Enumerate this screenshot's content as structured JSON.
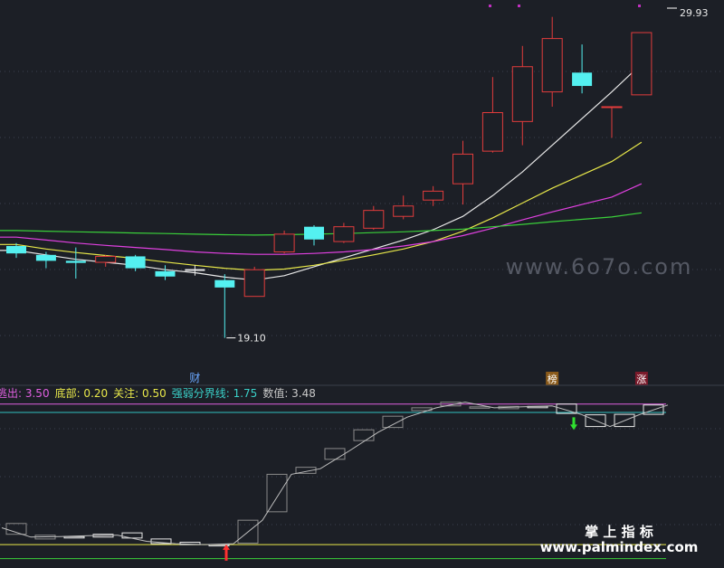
{
  "chart_data": [
    {
      "type": "candlestick",
      "panel": "price",
      "ylim": [
        17.5,
        30.5
      ],
      "max_label": "29.93",
      "min_label": "19.10",
      "candles": [
        {
          "open": 22.2,
          "close": 21.95,
          "high": 22.3,
          "low": 21.8,
          "color": "cyan"
        },
        {
          "open": 21.9,
          "close": 21.7,
          "high": 22.0,
          "low": 21.45,
          "color": "cyan"
        },
        {
          "open": 21.7,
          "close": 21.63,
          "high": 22.15,
          "low": 21.1,
          "color": "cyan"
        },
        {
          "open": 21.85,
          "close": 21.65,
          "high": 21.9,
          "low": 21.5,
          "color": "red"
        },
        {
          "open": 21.85,
          "close": 21.45,
          "high": 21.9,
          "low": 21.35,
          "color": "cyan"
        },
        {
          "open": 21.35,
          "close": 21.17,
          "high": 21.55,
          "low": 21.05,
          "color": "cyan"
        },
        {
          "open": 21.42,
          "close": 21.36,
          "high": 21.55,
          "low": 21.2,
          "color": "white"
        },
        {
          "open": 21.05,
          "close": 20.8,
          "high": 21.25,
          "low": 19.1,
          "color": "cyan"
        },
        {
          "open": 20.5,
          "close": 21.4,
          "high": 21.5,
          "low": 20.5,
          "color": "red"
        },
        {
          "open": 22.0,
          "close": 22.6,
          "high": 22.72,
          "low": 21.95,
          "color": "red"
        },
        {
          "open": 22.85,
          "close": 22.42,
          "high": 22.9,
          "low": 22.22,
          "color": "cyan"
        },
        {
          "open": 22.35,
          "close": 22.85,
          "high": 22.98,
          "low": 22.3,
          "color": "red"
        },
        {
          "open": 22.8,
          "close": 23.4,
          "high": 23.55,
          "low": 22.75,
          "color": "red"
        },
        {
          "open": 23.2,
          "close": 23.55,
          "high": 23.9,
          "low": 23.1,
          "color": "red"
        },
        {
          "open": 23.75,
          "close": 24.05,
          "high": 24.22,
          "low": 23.55,
          "color": "red"
        },
        {
          "open": 24.3,
          "close": 25.3,
          "high": 25.75,
          "low": 23.6,
          "color": "red"
        },
        {
          "open": 25.4,
          "close": 26.7,
          "high": 27.9,
          "low": 25.35,
          "color": "red"
        },
        {
          "open": 26.4,
          "close": 28.25,
          "high": 28.95,
          "low": 25.6,
          "color": "red"
        },
        {
          "open": 27.4,
          "close": 29.2,
          "high": 29.93,
          "low": 26.9,
          "color": "red"
        },
        {
          "open": 28.05,
          "close": 27.6,
          "high": 29.0,
          "low": 27.35,
          "color": "cyan"
        },
        {
          "open": 26.9,
          "close": 26.9,
          "high": 26.9,
          "low": 25.85,
          "color": "red"
        },
        {
          "open": 27.3,
          "close": 29.4,
          "high": 29.4,
          "low": 27.3,
          "color": "red"
        }
      ],
      "ma_lines": [
        {
          "color": "#e8e8e8",
          "values": [
            22.05,
            21.9,
            21.75,
            21.65,
            21.55,
            21.4,
            21.3,
            21.15,
            21.05,
            21.2,
            21.5,
            21.8,
            22.1,
            22.4,
            22.75,
            23.2,
            23.9,
            24.7,
            25.6,
            26.5,
            27.4,
            28.35
          ]
        },
        {
          "color": "#e8e84a",
          "values": [
            22.25,
            22.1,
            21.98,
            21.88,
            21.78,
            21.66,
            21.55,
            21.45,
            21.38,
            21.42,
            21.55,
            21.72,
            21.9,
            22.1,
            22.35,
            22.7,
            23.15,
            23.65,
            24.15,
            24.6,
            25.05,
            25.7
          ]
        },
        {
          "color": "#e040e0",
          "values": [
            22.5,
            22.4,
            22.3,
            22.22,
            22.15,
            22.08,
            22.0,
            21.95,
            21.92,
            21.92,
            21.95,
            22.0,
            22.08,
            22.2,
            22.35,
            22.55,
            22.8,
            23.08,
            23.35,
            23.6,
            23.85,
            24.3
          ]
        },
        {
          "color": "#3ad03a",
          "values": [
            22.72,
            22.7,
            22.68,
            22.66,
            22.64,
            22.62,
            22.6,
            22.58,
            22.57,
            22.58,
            22.6,
            22.62,
            22.65,
            22.68,
            22.72,
            22.77,
            22.85,
            22.93,
            23.02,
            23.1,
            23.18,
            23.32
          ]
        }
      ],
      "markers": [
        {
          "index": 6,
          "label": "财"
        },
        {
          "index": 18,
          "label": "榜"
        },
        {
          "index": 21,
          "label": "涨"
        }
      ]
    },
    {
      "type": "indicator",
      "panel": "lower",
      "ylim": [
        0,
        3.9
      ],
      "legend": [
        {
          "label": "逃出: 3.50",
          "color": "#e060e0"
        },
        {
          "label": "底部: 0.20",
          "color": "#e8e84a"
        },
        {
          "label": "关注: 0.50",
          "color": "#e8e84a"
        },
        {
          "label": "强弱分界线: 1.75",
          "color": "#3ad0c8"
        },
        {
          "label": "数值: 3.48",
          "color": "#c8c8c8"
        }
      ],
      "levels": [
        {
          "name": "逃出",
          "value": 3.5,
          "color": "#e060e0"
        },
        {
          "name": "强弱分界线",
          "value": 3.32,
          "color": "#30c0c0"
        },
        {
          "name": "关注",
          "value": 0.5,
          "color": "#e8e84a"
        },
        {
          "name": "底部",
          "value": 0.2,
          "color": "#3ad03a"
        }
      ],
      "boxes": [
        {
          "open": 0.72,
          "close": 0.95
        },
        {
          "open": 0.62,
          "close": 0.7
        },
        {
          "open": 0.67,
          "close": 0.67
        },
        {
          "open": 0.72,
          "close": 0.66
        },
        {
          "open": 0.75,
          "close": 0.64
        },
        {
          "open": 0.62,
          "close": 0.52
        },
        {
          "open": 0.55,
          "close": 0.5
        },
        {
          "open": 0.5,
          "close": 0.5
        },
        {
          "open": 0.53,
          "close": 1.02
        },
        {
          "open": 1.2,
          "close": 2.0
        },
        {
          "open": 2.02,
          "close": 2.15
        },
        {
          "open": 2.32,
          "close": 2.55
        },
        {
          "open": 2.72,
          "close": 2.95
        },
        {
          "open": 3.0,
          "close": 3.24
        },
        {
          "open": 3.36,
          "close": 3.42
        },
        {
          "open": 3.46,
          "close": 3.54
        },
        {
          "open": 3.43,
          "close": 3.44
        },
        {
          "open": 3.4,
          "close": 3.45
        },
        {
          "open": 3.45,
          "close": 3.45
        },
        {
          "open": 3.3,
          "close": 3.5
        },
        {
          "open": 3.02,
          "close": 3.27
        },
        {
          "open": 3.02,
          "close": 3.28
        },
        {
          "open": 3.48,
          "close": 3.28
        }
      ],
      "line": [
        0.86,
        0.66,
        0.67,
        0.69,
        0.7,
        0.57,
        0.52,
        0.5,
        0.52,
        1.02,
        2.0,
        2.12,
        2.5,
        2.9,
        3.22,
        3.42,
        3.54,
        3.42,
        3.44,
        3.46,
        3.28,
        3.02,
        3.27,
        3.48
      ],
      "signals": [
        {
          "index": 7,
          "direction": "up",
          "color": "#ff3030"
        },
        {
          "index": 19,
          "direction": "down",
          "color": "#30e030"
        }
      ]
    }
  ],
  "watermarks": {
    "site_top": "www.6o7o.com",
    "brand": "掌 上 指 标",
    "site_bottom": "www.palmindex.com"
  }
}
